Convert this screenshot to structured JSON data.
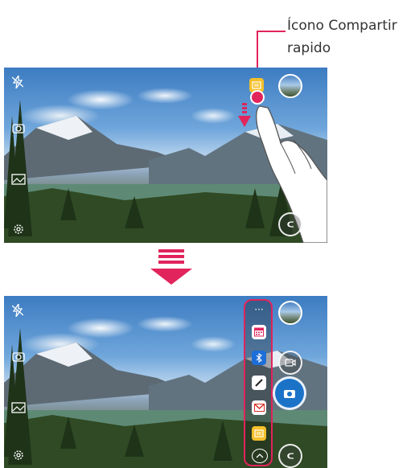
{
  "annotation": {
    "line1": "Ícono Compartir",
    "line2": "rapido"
  },
  "colors": {
    "accent": "#e1245c",
    "quick_share_yellow": "#f4c02b"
  },
  "top_screen": {
    "left_controls": [
      "flash-off-icon",
      "switch-camera-icon",
      "mode-icon",
      "settings-icon"
    ],
    "right_controls": [
      "quick-share-icon",
      "gallery-thumbnail",
      "back-button"
    ]
  },
  "bottom_screen": {
    "left_controls": [
      "flash-off-icon",
      "switch-camera-icon",
      "mode-icon",
      "settings-icon"
    ],
    "quick_share_apps": [
      "more-icon",
      "calendar-icon",
      "bluetooth-icon",
      "edit-icon",
      "gmail-icon",
      "memo-icon",
      "collapse-icon"
    ],
    "right_controls": [
      "gallery-thumbnail",
      "video-record-button",
      "capture-button",
      "back-button"
    ]
  }
}
